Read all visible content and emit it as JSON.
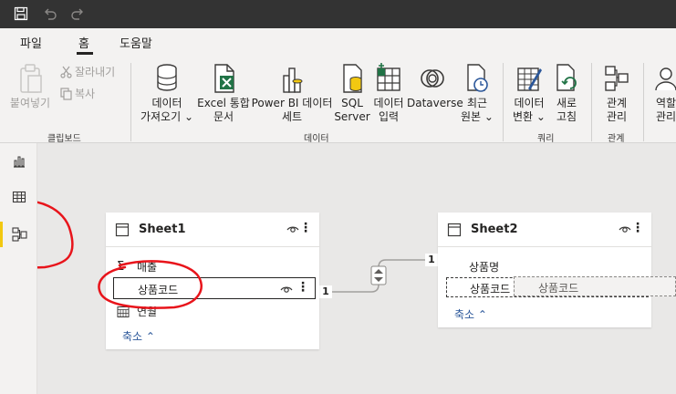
{
  "menu": {
    "file": "파일",
    "home": "홈",
    "help": "도움말"
  },
  "ribbon": {
    "clipboard": {
      "paste": "붙여넣기",
      "cut": "잘라내기",
      "copy": "복사",
      "group_label": "클립보드"
    },
    "data": {
      "get_data_line1": "데이터",
      "get_data_line2": "가져오기",
      "excel_line1": "Excel 통합",
      "excel_line2": "문서",
      "powerbi_line1": "Power BI 데이터",
      "powerbi_line2": "세트",
      "sql_line1": "SQL",
      "sql_line2": "Server",
      "enter_line1": "데이터",
      "enter_line2": "입력",
      "dataverse": "Dataverse",
      "recent_line1": "최근",
      "recent_line2": "원본",
      "group_label": "데이터"
    },
    "query": {
      "transform_line1": "데이터",
      "transform_line2": "변환",
      "refresh_line1": "새로",
      "refresh_line2": "고침",
      "group_label": "쿼리"
    },
    "relations": {
      "manage_line1": "관계",
      "manage_line2": "관리",
      "group_label": "관계"
    },
    "security": {
      "role_line1": "역할",
      "role_line2": "관리"
    }
  },
  "sheet1": {
    "title": "Sheet1",
    "fields": [
      "매출",
      "상품코드",
      "연월"
    ],
    "collapse": "축소"
  },
  "sheet2": {
    "title": "Sheet2",
    "fields": [
      "상품명",
      "상품코드"
    ],
    "drag_field": "상품코드",
    "collapse": "축소"
  },
  "relationship": {
    "left_cardinality": "1",
    "right_cardinality": "1"
  },
  "colors": {
    "titlebar": "#333333",
    "ribbon": "#f3f2f1",
    "canvas": "#e9e8e7",
    "annotation": "#e8141b",
    "excel_green": "#217346",
    "link_blue": "#2b579a"
  }
}
